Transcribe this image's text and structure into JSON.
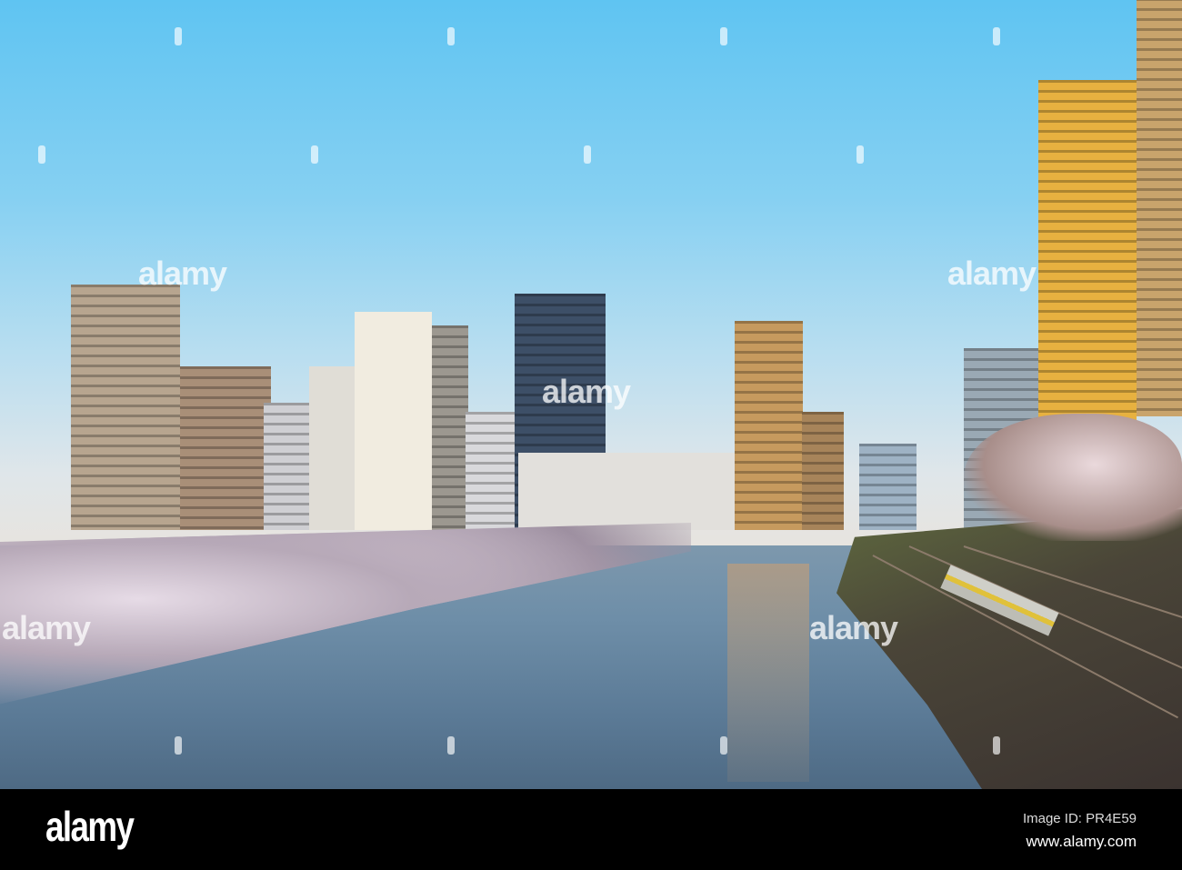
{
  "watermark": {
    "text": "alamy"
  },
  "footer": {
    "logo": "alamy",
    "image_id": "Image ID: PR4E59",
    "site": "www.alamy.com"
  }
}
